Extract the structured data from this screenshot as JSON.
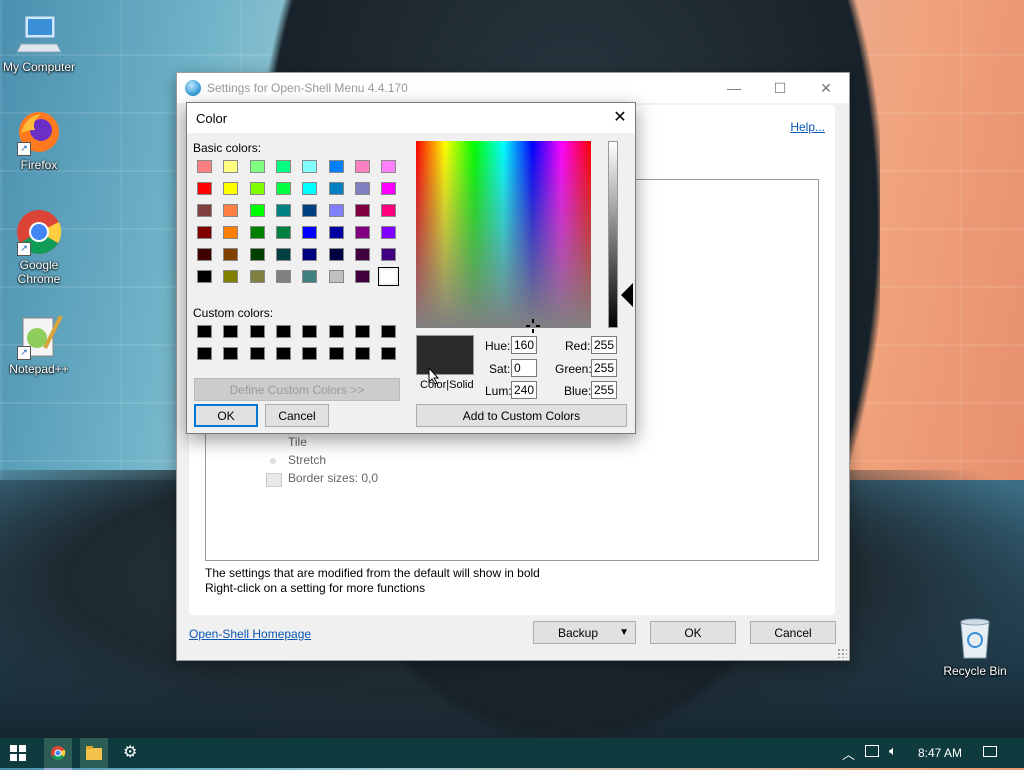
{
  "desktop": {
    "icons": [
      {
        "label": "My Computer",
        "name": "my-computer"
      },
      {
        "label": "Firefox",
        "name": "firefox"
      },
      {
        "label": "Google Chrome",
        "name": "google-chrome"
      },
      {
        "label": "Notepad++",
        "name": "notepad-plus-plus"
      },
      {
        "label": "Recycle Bin",
        "name": "recycle-bin"
      }
    ]
  },
  "settings_window": {
    "title": "Settings for Open-Shell Menu 4.4.170",
    "help_link": "Help...",
    "panel_items": [
      "Tile",
      "Stretch",
      "Border sizes: 0,0"
    ],
    "note_line1": "The settings that are modified from the default will show in bold",
    "note_line2": "Right-click on a setting for more functions",
    "homepage_link": "Open-Shell Homepage",
    "backup_label": "Backup",
    "ok_label": "OK",
    "cancel_label": "Cancel"
  },
  "color_dialog": {
    "title": "Color",
    "basic_colors_label": "Basic colors:",
    "custom_colors_label": "Custom colors:",
    "define_custom_label": "Define Custom Colors >>",
    "ok_label": "OK",
    "cancel_label": "Cancel",
    "color_solid_label": "Color|Solid",
    "add_custom_label": "Add to Custom Colors",
    "hue_label": "Hue:",
    "hue_value": "160",
    "sat_label": "Sat:",
    "sat_value": "0",
    "lum_label": "Lum:",
    "lum_value": "240",
    "red_label": "Red:",
    "red_value": "255",
    "green_label": "Green:",
    "green_value": "255",
    "blue_label": "Blue:",
    "blue_value": "255",
    "preview_color": "#2b2b2b",
    "basic_colors": [
      [
        "#ff8080",
        "#ffff80",
        "#80ff80",
        "#00ff80",
        "#80ffff",
        "#0080ff",
        "#ff80c0",
        "#ff80ff"
      ],
      [
        "#ff0000",
        "#ffff00",
        "#80ff00",
        "#00ff40",
        "#00ffff",
        "#0080c0",
        "#8080c0",
        "#ff00ff"
      ],
      [
        "#804040",
        "#ff8040",
        "#00ff00",
        "#008080",
        "#004080",
        "#8080ff",
        "#800040",
        "#ff0080"
      ],
      [
        "#800000",
        "#ff8000",
        "#008000",
        "#008040",
        "#0000ff",
        "#0000a0",
        "#800080",
        "#8000ff"
      ],
      [
        "#400000",
        "#804000",
        "#004000",
        "#004040",
        "#000080",
        "#000040",
        "#400040",
        "#400080"
      ],
      [
        "#000000",
        "#808000",
        "#808040",
        "#808080",
        "#408080",
        "#c0c0c0",
        "#400040",
        "#ffffff"
      ]
    ],
    "custom_colors": [
      [
        "#000000",
        "#000000",
        "#000000",
        "#000000",
        "#000000",
        "#000000",
        "#000000",
        "#000000"
      ],
      [
        "#000000",
        "#000000",
        "#000000",
        "#000000",
        "#000000",
        "#000000",
        "#000000",
        "#000000"
      ]
    ]
  },
  "taskbar": {
    "time": "8:47 AM"
  }
}
